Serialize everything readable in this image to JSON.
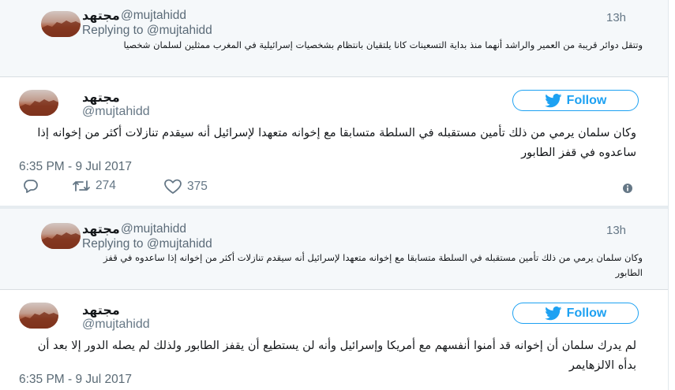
{
  "thread": {
    "reply1": {
      "author_name": "مجتهد",
      "handle": "@mujtahidd",
      "time": "13h",
      "replying_to": "Replying to @mujtahidd",
      "text": "وتتقل دوائر قريبة من العمير والراشد أنهما منذ بداية التسعينات كانا يلتقيان بانتظام بشخصيات إسرائيلية في المغرب ممثلين لسلمان شخصيا"
    },
    "main1": {
      "author_name": "مجتهد",
      "handle": "@mujtahidd",
      "follow_label": "Follow",
      "text": "وكان سلمان يرمي من ذلك تأمين مستقبله في السلطة متسابقا مع إخوانه متعهدا لإسرائيل أنه سيقدم تنازلات أكثر من إخوانه إذا ساعدوه في قفز الطابور",
      "timestamp": "6:35 PM - 9 Jul 2017",
      "retweets": "274",
      "likes": "375"
    },
    "reply2": {
      "author_name": "مجتهد",
      "handle": "@mujtahidd",
      "time": "13h",
      "replying_to": "Replying to @mujtahidd",
      "text": "وكان سلمان يرمي من ذلك تأمين مستقبله في السلطة متسابقا مع إخوانه متعهدا لإسرائيل أنه سيقدم تنازلات أكثر من إخوانه إذا ساعدوه في قفز الطابور"
    },
    "main2": {
      "author_name": "مجتهد",
      "handle": "@mujtahidd",
      "follow_label": "Follow",
      "text": "لم يدرك سلمان أن إخوانه قد أمنوا أنفسهم مع أمريكا وإسرائيل وأنه لن يستطيع أن يقفز الطابور ولذلك لم يصله الدور إلا بعد أن بدأه الالزهايمر",
      "timestamp": "6:35 PM - 9 Jul 2017"
    }
  },
  "colors": {
    "twitter_blue": "#1da1f2",
    "reply_bg": "#f5f8fa",
    "muted": "#657786"
  },
  "icons": [
    "reply-icon",
    "retweet-icon",
    "heart-icon",
    "info-icon",
    "twitter-bird-icon"
  ]
}
